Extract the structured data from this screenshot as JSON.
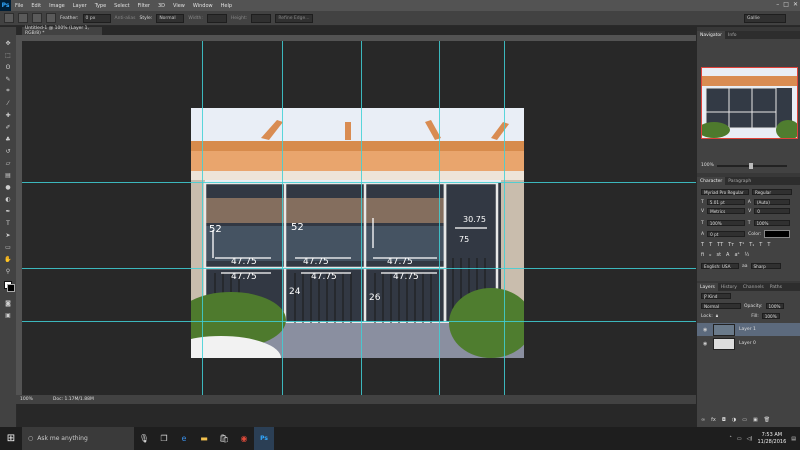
{
  "app": {
    "logo": "Ps"
  },
  "menu": [
    "File",
    "Edit",
    "Image",
    "Layer",
    "Type",
    "Select",
    "Filter",
    "3D",
    "View",
    "Window",
    "Help"
  ],
  "options": {
    "feather_label": "Feather:",
    "feather_value": "0 px",
    "anti_alias_label": "Anti-alias",
    "style_label": "Style:",
    "style_value": "Normal",
    "width_label": "Width:",
    "height_label": "Height:",
    "refine_edge": "Refine Edge...",
    "workspace": "Gallie"
  },
  "document": {
    "tab_title": "Untitled-1 @ 100% (Layer 1, RGB/8) *",
    "zoom": "100%",
    "doc_info": "Doc: 1.17M/1.88M"
  },
  "panels": {
    "navigator_tabs": [
      "Navigator",
      "Info"
    ],
    "navigator_zoom": "100%",
    "character_tabs": [
      "Character",
      "Paragraph"
    ],
    "character": {
      "font_family": "Myriad Pro Regular",
      "font_style": "Regular",
      "font_size": "5.01 pt",
      "leading": "(Auto)",
      "kerning": "Metrics",
      "tracking": "0",
      "vscale": "100%",
      "hscale": "100%",
      "baseline": "0 pt",
      "color_label": "Color:",
      "language": "English: USA",
      "antialias": "Sharp"
    },
    "layers_tabs": [
      "Layers",
      "History",
      "Channels",
      "Paths"
    ],
    "layers": {
      "filter": "Ƿ Kind",
      "blend": "Normal",
      "opacity_label": "Opacity:",
      "opacity": "100%",
      "lock_label": "Lock:",
      "fill_label": "Fill:",
      "fill": "100%",
      "items": [
        "Layer 1",
        "Layer 0"
      ]
    }
  },
  "taskbar": {
    "search_placeholder": "Ask me anything",
    "time": "7:53 AM",
    "date": "11/28/2016"
  },
  "sketch": {
    "labels": [
      "52",
      "47.75",
      "47.75",
      "47.75",
      "47.75",
      "47.75",
      "47.75",
      "24",
      "26",
      "52",
      "30.75",
      "75"
    ],
    "colors": {
      "guide": "#3fd0d6",
      "accent": "#31a8ff"
    }
  }
}
